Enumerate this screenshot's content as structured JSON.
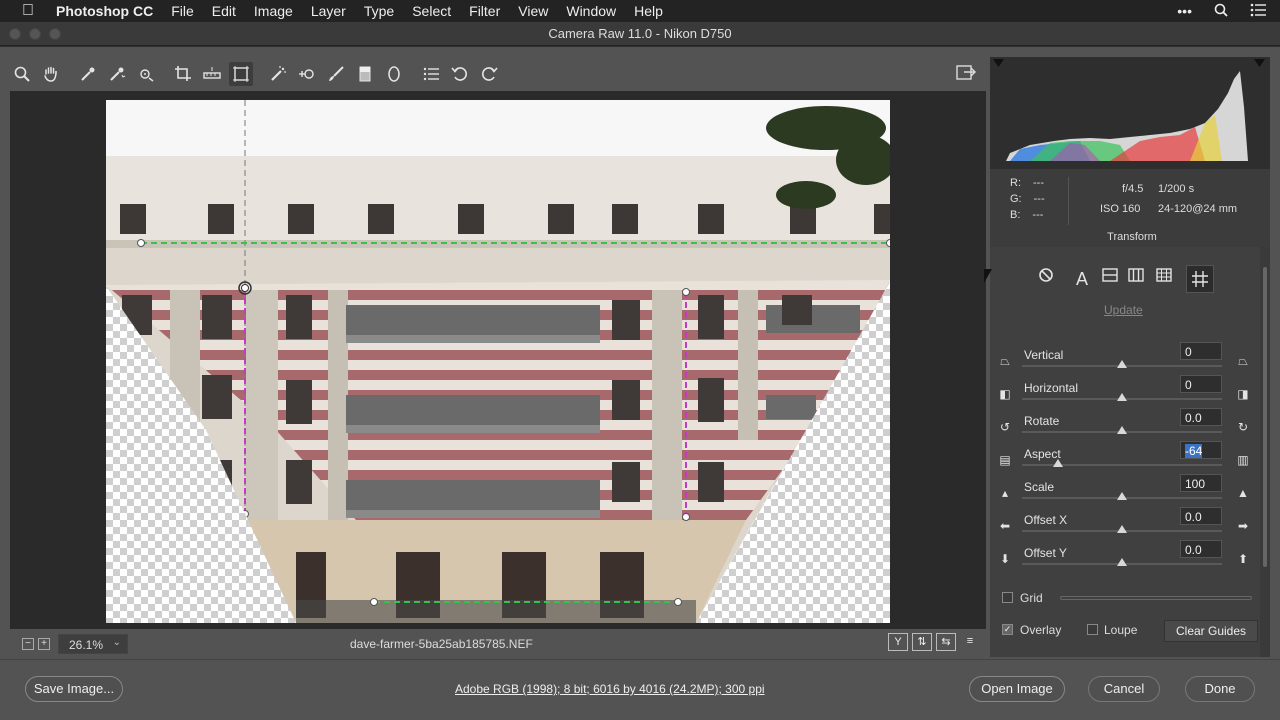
{
  "menubar": {
    "app_name": "Photoshop CC",
    "items": [
      "File",
      "Edit",
      "Image",
      "Layer",
      "Type",
      "Select",
      "Filter",
      "View",
      "Window",
      "Help"
    ],
    "more_icon": "•••"
  },
  "window": {
    "title": "Camera Raw 11.0  -  Nikon D750"
  },
  "canvas": {
    "zoom_level": "26.1%",
    "filename": "dave-farmer-5ba25ab185785.NEF",
    "view_buttons": [
      "Y",
      "⇅",
      "⇆",
      "≡"
    ]
  },
  "info": {
    "r_label": "R:",
    "r_value": "---",
    "g_label": "G:",
    "g_value": "---",
    "b_label": "B:",
    "b_value": "---",
    "aperture": "f/4.5",
    "shutter": "1/200 s",
    "iso": "ISO 160",
    "lens": "24-120@24 mm"
  },
  "panel": {
    "title": "Transform",
    "update_label": "Update",
    "sliders": [
      {
        "label": "Vertical",
        "value": "0",
        "position": 0.5
      },
      {
        "label": "Horizontal",
        "value": "0",
        "position": 0.5
      },
      {
        "label": "Rotate",
        "value": "0.0",
        "position": 0.5
      },
      {
        "label": "Aspect",
        "value": "-64",
        "position": 0.18,
        "selected": true
      },
      {
        "label": "Scale",
        "value": "100",
        "position": 0.5
      },
      {
        "label": "Offset X",
        "value": "0.0",
        "position": 0.5
      },
      {
        "label": "Offset Y",
        "value": "0.0",
        "position": 0.5
      }
    ],
    "grid_label": "Grid",
    "overlay_label": "Overlay",
    "overlay_checked": true,
    "loupe_label": "Loupe",
    "loupe_checked": false,
    "clear_guides_label": "Clear Guides"
  },
  "footer": {
    "save_label": "Save Image...",
    "workflow_options": "Adobe RGB (1998); 8 bit; 6016 by 4016 (24.2MP); 300 ppi",
    "open_label": "Open Image",
    "cancel_label": "Cancel",
    "done_label": "Done"
  },
  "colors": {
    "guide_green": "#36c24b",
    "guide_magenta": "#c23bc2",
    "selection_blue": "#3b72c4"
  }
}
